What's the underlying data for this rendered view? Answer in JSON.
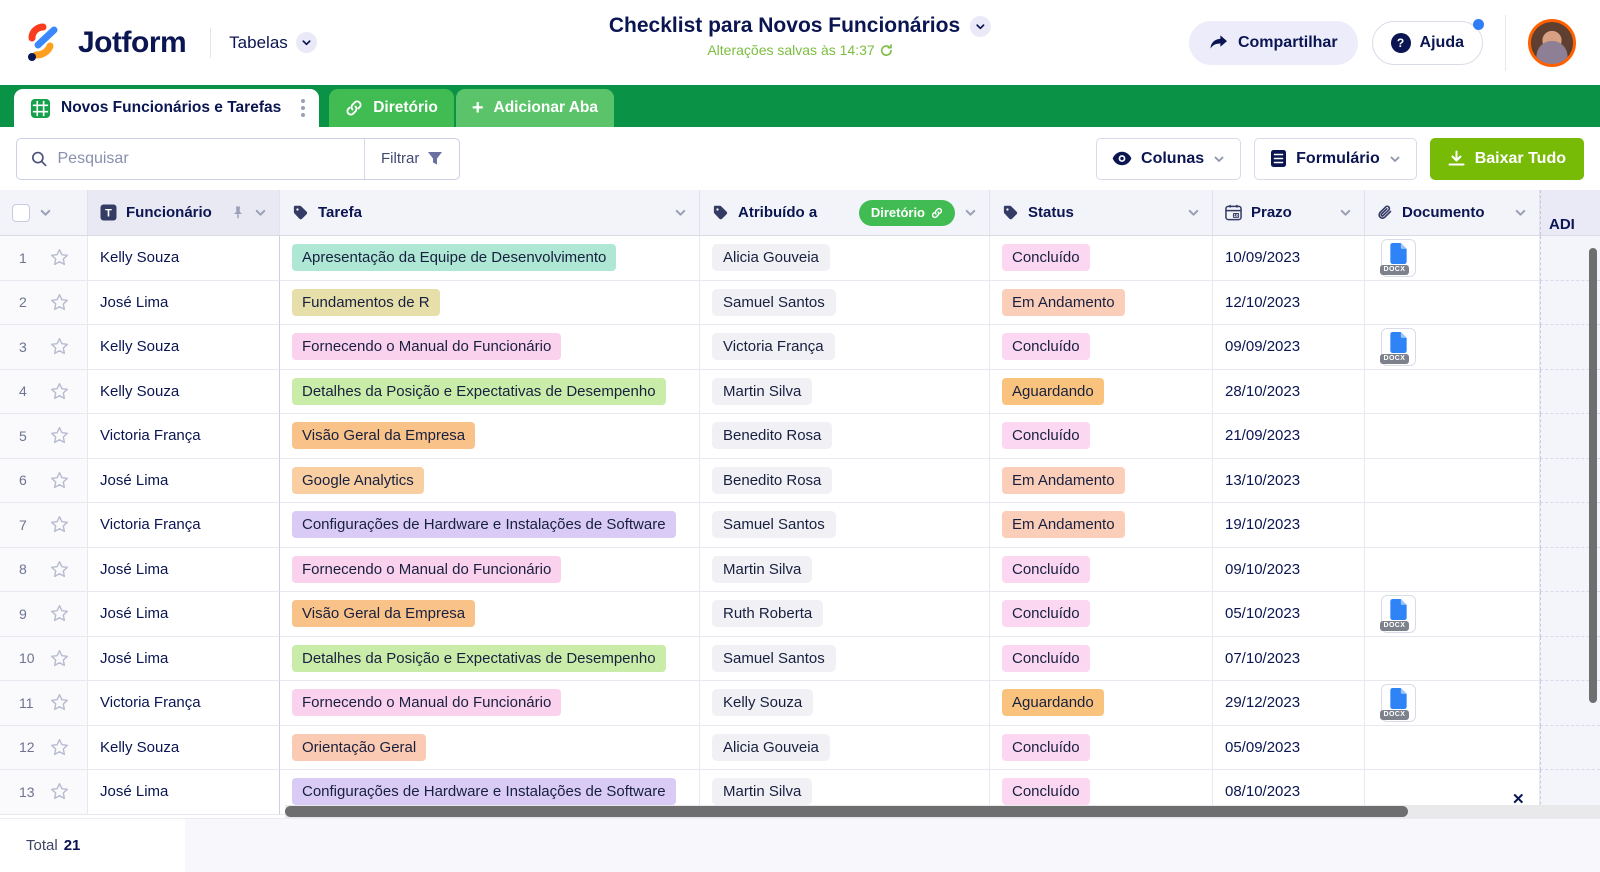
{
  "brand": {
    "logo_text": "Jotform",
    "product": "Tabelas"
  },
  "header": {
    "title": "Checklist para Novos Funcionários",
    "saved_status": "Alterações salvas às 14:37",
    "share_label": "Compartilhar",
    "help_label": "Ajuda"
  },
  "tabs": [
    {
      "label": "Novos Funcionários e Tarefas",
      "active": true
    },
    {
      "label": "Diretório",
      "active": false
    },
    {
      "label": "Adicionar Aba",
      "active": false
    }
  ],
  "toolbar": {
    "search_placeholder": "Pesquisar",
    "filter_label": "Filtrar",
    "columns_label": "Colunas",
    "form_label": "Formulário",
    "download_label": "Baixar Tudo"
  },
  "table": {
    "columns": {
      "funcionario": "Funcionário",
      "tarefa": "Tarefa",
      "atribuido": "Atribuído a",
      "status": "Status",
      "prazo": "Prazo",
      "documento": "Documento"
    },
    "linked_badge": "Diretório",
    "add_column_label": "ADI",
    "doc_type_label": "DOCX",
    "status_colors": {
      "Concluído": "#fbd7f1",
      "Em Andamento": "#fbceb9",
      "Aguardando": "#f9c37e"
    },
    "rows": [
      {
        "num": "1",
        "funcionario": "Kelly Souza",
        "tarefa": "Apresentação da Equipe de Desenvolvimento",
        "tarefa_color": "#aee8d5",
        "atribuido": "Alicia Gouveia",
        "status": "Concluído",
        "prazo": "10/09/2023",
        "doc": true
      },
      {
        "num": "2",
        "funcionario": "José Lima",
        "tarefa": "Fundamentos de R",
        "tarefa_color": "#e6dfa9",
        "atribuido": "Samuel Santos",
        "status": "Em Andamento",
        "prazo": "12/10/2023",
        "doc": false
      },
      {
        "num": "3",
        "funcionario": "Kelly Souza",
        "tarefa": "Fornecendo o Manual do Funcionário",
        "tarefa_color": "#fbd2ee",
        "atribuido": "Victoria França",
        "status": "Concluído",
        "prazo": "09/09/2023",
        "doc": true
      },
      {
        "num": "4",
        "funcionario": "Kelly Souza",
        "tarefa": "Detalhes da Posição e Expectativas de Desempenho",
        "tarefa_color": "#c9eda9",
        "atribuido": "Martin Silva",
        "status": "Aguardando",
        "prazo": "28/10/2023",
        "doc": false
      },
      {
        "num": "5",
        "funcionario": "Victoria França",
        "tarefa": "Visão Geral da Empresa",
        "tarefa_color": "#f9c288",
        "atribuido": "Benedito Rosa",
        "status": "Concluído",
        "prazo": "21/09/2023",
        "doc": false
      },
      {
        "num": "6",
        "funcionario": "José Lima",
        "tarefa": "Google Analytics",
        "tarefa_color": "#f9cfa1",
        "atribuido": "Benedito Rosa",
        "status": "Em Andamento",
        "prazo": "13/10/2023",
        "doc": false
      },
      {
        "num": "7",
        "funcionario": "Victoria França",
        "tarefa": "Configurações de Hardware e Instalações de Software",
        "tarefa_color": "#d9cbf6",
        "atribuido": "Samuel Santos",
        "status": "Em Andamento",
        "prazo": "19/10/2023",
        "doc": false
      },
      {
        "num": "8",
        "funcionario": "José Lima",
        "tarefa": "Fornecendo o Manual do Funcionário",
        "tarefa_color": "#fbd2ee",
        "atribuido": "Martin Silva",
        "status": "Concluído",
        "prazo": "09/10/2023",
        "doc": false
      },
      {
        "num": "9",
        "funcionario": "José Lima",
        "tarefa": "Visão Geral da Empresa",
        "tarefa_color": "#f9c288",
        "atribuido": "Ruth Roberta",
        "status": "Concluído",
        "prazo": "05/10/2023",
        "doc": true
      },
      {
        "num": "10",
        "funcionario": "José Lima",
        "tarefa": "Detalhes da Posição e Expectativas de Desempenho",
        "tarefa_color": "#c9eda9",
        "atribuido": "Samuel Santos",
        "status": "Concluído",
        "prazo": "07/10/2023",
        "doc": false
      },
      {
        "num": "11",
        "funcionario": "Victoria França",
        "tarefa": "Fornecendo o Manual do Funcionário",
        "tarefa_color": "#fbd2ee",
        "atribuido": "Kelly Souza",
        "status": "Aguardando",
        "prazo": "29/12/2023",
        "doc": true
      },
      {
        "num": "12",
        "funcionario": "Kelly Souza",
        "tarefa": "Orientação Geral",
        "tarefa_color": "#fbcab2",
        "atribuido": "Alicia Gouveia",
        "status": "Concluído",
        "prazo": "05/09/2023",
        "doc": false
      },
      {
        "num": "13",
        "funcionario": "José Lima",
        "tarefa": "Configurações de Hardware e Instalações de Software",
        "tarefa_color": "#d9cbf6",
        "atribuido": "Martin Silva",
        "status": "Concluído",
        "prazo": "08/10/2023",
        "doc": false
      }
    ],
    "footer": {
      "total_label": "Total",
      "total_value": "21"
    }
  },
  "colors": {
    "accent_navy": "#0a1551",
    "tabbar_green": "#0a9246",
    "tab_green": "#41bc52",
    "tab_light_green": "#5bc46a",
    "download_green": "#78bb07",
    "saved_text_green": "#7cbe3f",
    "avatar_ring_orange": "#ff6100",
    "notification_blue": "#2f7ef7"
  }
}
